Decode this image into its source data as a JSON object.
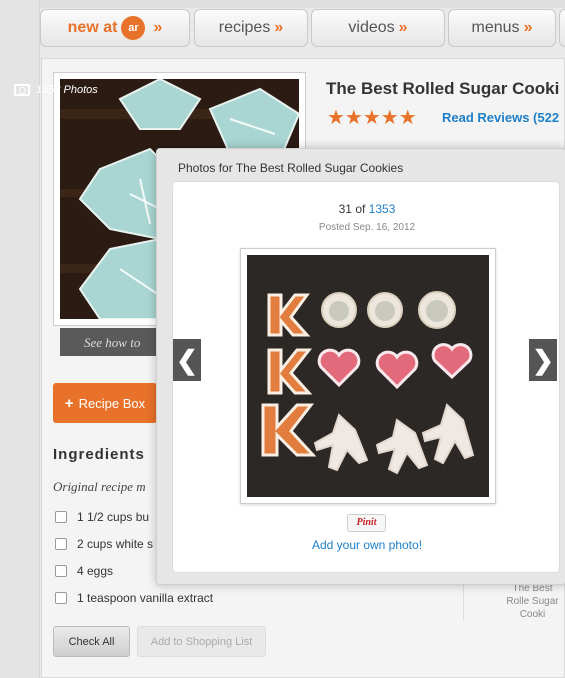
{
  "nav": {
    "tabs": [
      {
        "label": "new at",
        "logo": "ar",
        "arrow": "»"
      },
      {
        "label": "recipes",
        "arrow": "»"
      },
      {
        "label": "videos",
        "arrow": "»"
      },
      {
        "label": "menus",
        "arrow": "»"
      }
    ]
  },
  "recipe": {
    "photo_count": "1353 Photos",
    "see_how": "See how to",
    "title": "The Best Rolled Sugar Cooki",
    "rating_stars": "★★★★★",
    "read_reviews": "Read Reviews (522",
    "recipe_box": "Recipe Box",
    "ingredients_heading": "Ingredients",
    "original_recipe": "Original recipe m",
    "ingredients": [
      "1 1/2 cups bu",
      "2 cups white s",
      "4 eggs",
      "1 teaspoon vanilla extract"
    ],
    "check_all": "Check All",
    "add_to_shopping": "Add to Shopping List",
    "side_text": "The Best Rolle Sugar Cooki"
  },
  "modal": {
    "title": "Photos for The Best Rolled Sugar Cookies",
    "current": "31",
    "of_label": "of",
    "total": "1353",
    "posted": "Posted Sep. 16, 2012",
    "pin_label": "Pinit",
    "add_photo": "Add your own photo!",
    "prev_arrow": "❮",
    "next_arrow": "❯"
  },
  "colors": {
    "accent": "#e8722a",
    "link": "#1e7fc8"
  }
}
